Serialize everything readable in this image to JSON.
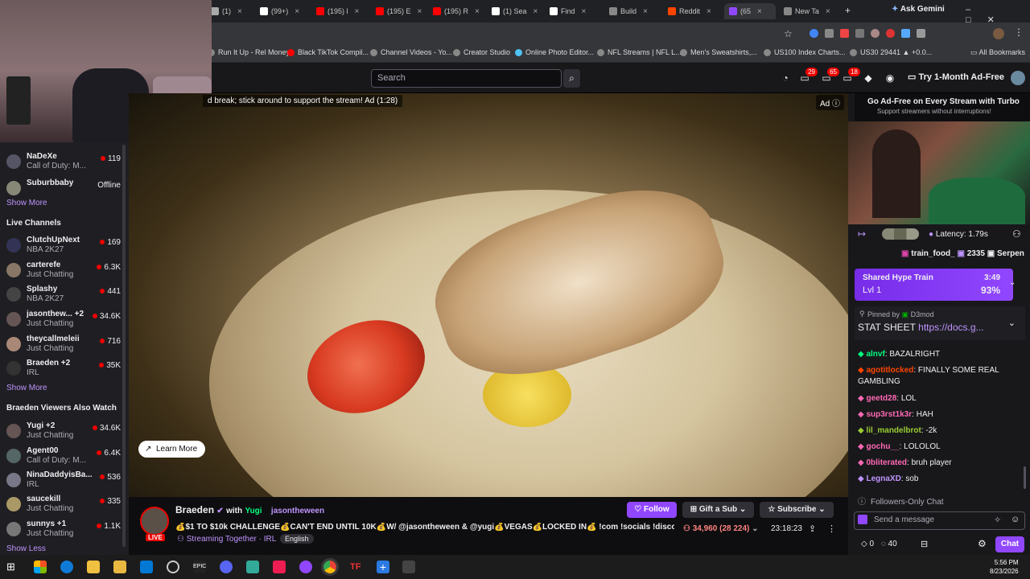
{
  "browser": {
    "tabs": [
      {
        "label": "(1)",
        "color": "#aaa"
      },
      {
        "label": "(99+)",
        "color": "#fff"
      },
      {
        "label": "(195) l",
        "color": "#ff0000"
      },
      {
        "label": "(195) E",
        "color": "#ff0000"
      },
      {
        "label": "(195) R",
        "color": "#ff0000"
      },
      {
        "label": "(1) Sea",
        "color": "#fff"
      },
      {
        "label": "Find",
        "color": "#fff"
      },
      {
        "label": "Build",
        "color": "#888"
      },
      {
        "label": "Reddit",
        "color": "#ff4500"
      },
      {
        "label": "(65",
        "color": "#9147ff"
      },
      {
        "label": "New Ta",
        "color": "#888"
      }
    ],
    "ask_gemini": "Ask Gemini",
    "bookmarks": [
      {
        "label": "Run It Up - Rel Money",
        "color": "#888"
      },
      {
        "label": "Black TikTok Compil...",
        "color": "#ff0000"
      },
      {
        "label": "Channel Videos - Yo...",
        "color": "#888"
      },
      {
        "label": "Creator Studio",
        "color": "#888"
      },
      {
        "label": "Online Photo Editor...",
        "color": "#4fc3f7"
      },
      {
        "label": "NFL Streams | NFL L...",
        "color": "#888"
      },
      {
        "label": "Men's Sweatshirts,...",
        "color": "#888"
      },
      {
        "label": "US100 Index Charts...",
        "color": "#888"
      },
      {
        "label": "US30 29441 ▲ +0.0...",
        "color": "#888"
      }
    ],
    "all_bookmarks": "All Bookmarks"
  },
  "nav": {
    "search_placeholder": "Search",
    "badge1": "29",
    "badge2": "65",
    "badge3": "18",
    "turbo": "Try 1-Month Ad-Free"
  },
  "sidebar": {
    "top_channels": [
      {
        "name": "NaDeXe",
        "game": "Call of Duty: M...",
        "viewers": "119",
        "live": true,
        "color": "#556"
      },
      {
        "name": "Suburbbaby",
        "game": "",
        "viewers": "Offline",
        "live": false,
        "color": "#887"
      }
    ],
    "show_more_1": "Show More",
    "live_header": "Live Channels",
    "live": [
      {
        "name": "ClutchUpNext",
        "game": "NBA 2K27",
        "viewers": "169",
        "color": "#335"
      },
      {
        "name": "carterefe",
        "game": "Just Chatting",
        "viewers": "6.3K",
        "color": "#876"
      },
      {
        "name": "Splashy",
        "game": "NBA 2K27",
        "viewers": "441",
        "color": "#444"
      },
      {
        "name": "jasonthew... +2",
        "game": "Just Chatting",
        "viewers": "34.6K",
        "color": "#655"
      },
      {
        "name": "theycallmeleii",
        "game": "Just Chatting",
        "viewers": "716",
        "color": "#a87"
      },
      {
        "name": "Braeden +2",
        "game": "IRL",
        "viewers": "35K",
        "color": "#333"
      }
    ],
    "show_more_2": "Show More",
    "also_header": "Braeden Viewers Also Watch",
    "also": [
      {
        "name": "Yugi +2",
        "game": "Just Chatting",
        "viewers": "34.6K",
        "color": "#655"
      },
      {
        "name": "Agent00",
        "game": "Call of Duty: M...",
        "viewers": "6.4K",
        "color": "#566"
      },
      {
        "name": "NinaDaddyisBa...",
        "game": "IRL",
        "viewers": "536",
        "color": "#778"
      },
      {
        "name": "saucekill",
        "game": "Just Chatting",
        "viewers": "335",
        "color": "#a96"
      },
      {
        "name": "sunnys +1",
        "game": "Just Chatting",
        "viewers": "1.1K",
        "color": "#777"
      }
    ],
    "show_less": "Show Less"
  },
  "video": {
    "ad_text": "d break; stick around to support the stream! Ad (1:28)",
    "ad_tag": "Ad",
    "learn_more": "Learn More"
  },
  "stream": {
    "streamer": "Braeden",
    "with": "with",
    "collab1": "Yugi",
    "collab2": "jasontheween",
    "title": "💰$1 TO $10k CHALLENGE💰CAN'T END UNTIL 10K💰W/ @jasontheween & @yugi💰VEGAS💰LOCKED IN💰 !com !socials !discord !base",
    "live": "LIVE",
    "streaming_together": "Streaming Together · IRL",
    "tag": "English",
    "follow": "Follow",
    "gift": "Gift a Sub",
    "subscribe": "Subscribe",
    "viewers": "34,960 (28 224)",
    "uptime": "23:18:23"
  },
  "chat": {
    "turbo_title": "Go Ad-Free on Every Stream with Turbo",
    "turbo_sub": "Support streamers without interruptions!",
    "latency": "Latency: 1.79s",
    "gifters": [
      {
        "name": "train_food_",
        "count": "2335"
      },
      {
        "name": "Serpen",
        "count": ""
      }
    ],
    "hype_title": "Shared Hype Train",
    "hype_time": "3:49",
    "hype_level": "Lvl 1",
    "hype_pct": "93%",
    "pinned_by": "Pinned by",
    "pinned_mod": "D3mod",
    "pinned_text": "STAT SHEET",
    "pinned_link": "https://docs.g...",
    "messages": [
      {
        "user": "alnvf",
        "text": ": BAZALRIGHT",
        "color": "#00ff7f"
      },
      {
        "user": "agotitlocked",
        "text": ": FINALLY SOME REAL GAMBLING",
        "color": "#ff4500"
      },
      {
        "user": "geetd28",
        "text": ": LOL",
        "color": "#ff69b4"
      },
      {
        "user": "sup3rst1k3r",
        "text": ": HAH",
        "color": "#ff69b4"
      },
      {
        "user": "lil_mandelbrot",
        "text": ": -2k",
        "color": "#9acd32"
      },
      {
        "user": "gochu__",
        "text": ": LOLOLOL",
        "color": "#ff69b4"
      },
      {
        "user": "0bliterated",
        "text": ": bruh player",
        "color": "#ff69b4"
      },
      {
        "user": "LegnaXD",
        "text": ": sob",
        "color": "#bf94ff"
      }
    ],
    "followers_only": "Followers-Only Chat",
    "send_placeholder": "Send a message",
    "points1": "0",
    "points2": "40",
    "chat_button": "Chat"
  },
  "taskbar": {
    "time": "5:56 PM",
    "date": "8/23/2026"
  }
}
